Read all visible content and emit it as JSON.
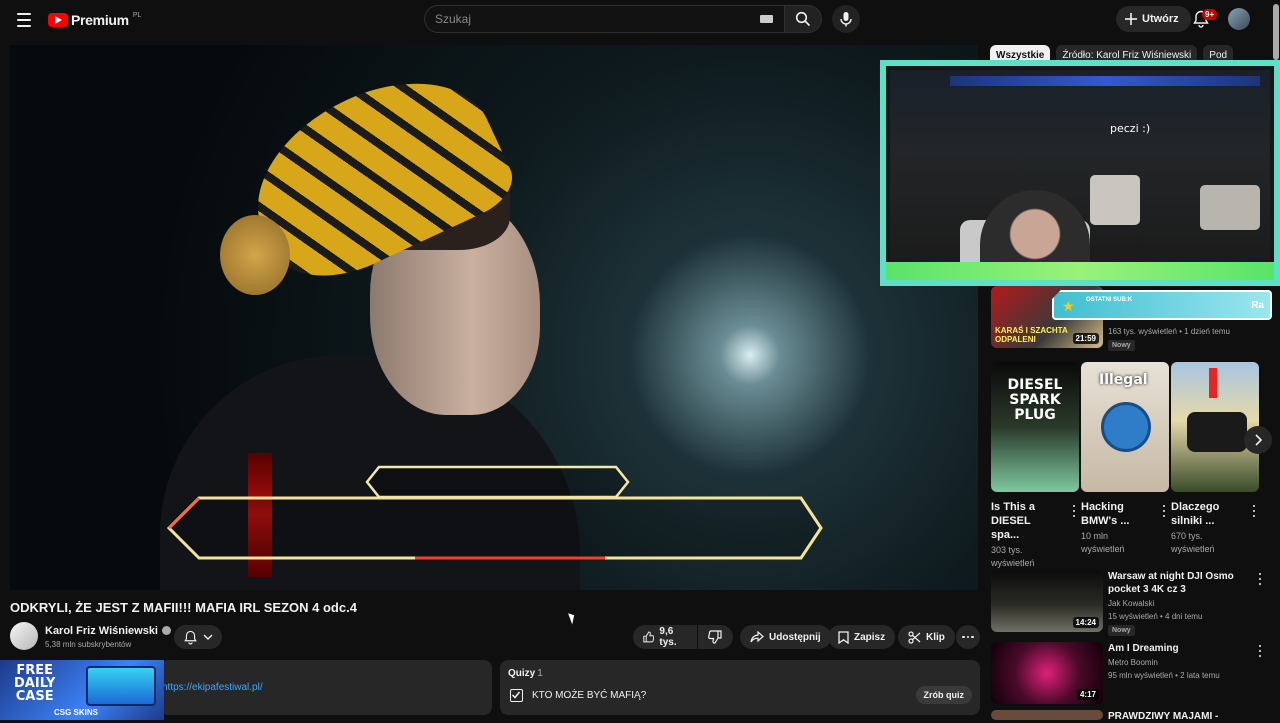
{
  "header": {
    "brand": "Premium",
    "country": "PL",
    "search_placeholder": "Szukaj",
    "create_label": "Utwórz",
    "notifications": "9+"
  },
  "chips": [
    "Wszystkie",
    "Źródło: Karol Friz Wiśniewski",
    "Pod"
  ],
  "overlay": {
    "cam_text": "peczi :)",
    "sub_label": "OSTATNI SUB:K",
    "sub_name": "Ra"
  },
  "recommendations": [
    {
      "title": "",
      "thumb_text": "KARAŚ I SZACHTA ODPALENI",
      "duration": "21:59",
      "channel": "",
      "meta": "163 tys. wyświetleń • 1 dzień temu",
      "badge": "Nowy"
    },
    {
      "title": "Warsaw at night  DJI Osmo pocket 3 4K cz  3",
      "duration": "14:24",
      "channel": "Jak Kowalski",
      "meta": "15 wyświetleń • 4 dni temu",
      "badge": "Nowy"
    },
    {
      "title": "Am I Dreaming",
      "duration": "4:17",
      "channel": "Metro Boomin",
      "meta": "95 mln wyświetleń • 2 lata temu",
      "badge": ""
    },
    {
      "title": "PRAWDZIWY MAJAMI -",
      "duration": "",
      "channel": "",
      "meta": "",
      "badge": ""
    }
  ],
  "shorts": [
    {
      "thumb_text": "DIESEL SPARK PLUG",
      "title": "Is This a DIESEL spa...",
      "meta": "303 tys. wyświetleń"
    },
    {
      "thumb_text": "Illegal",
      "title": "Hacking BMW's ...",
      "meta": "10 mln wyświetleń"
    },
    {
      "thumb_text": "",
      "title": "Dlaczego silniki ...",
      "meta": "670 tys. wyświetleń"
    }
  ],
  "video": {
    "title": "ODKRYLI, ŻE JEST Z MAFII!!! MAFIA IRL SEZON 4 odc.4",
    "channel": "Karol Friz Wiśniewski",
    "subscribers": "5,38 mln subskrybentów",
    "likes": "9,6 tys.",
    "share": "Udostępnij",
    "save": "Zapisz",
    "clip": "Klip"
  },
  "description": {
    "link": "https://ekipafestiwal.pl/"
  },
  "ad": {
    "line1": "FREE",
    "line2": "DAILY",
    "line3": "CASE",
    "brand": "CSG SKINS"
  },
  "quiz": {
    "header": "Quizy",
    "count": "1",
    "question": "KTO MOŻE BYĆ MAFIĄ?",
    "button": "Zrób quiz"
  }
}
